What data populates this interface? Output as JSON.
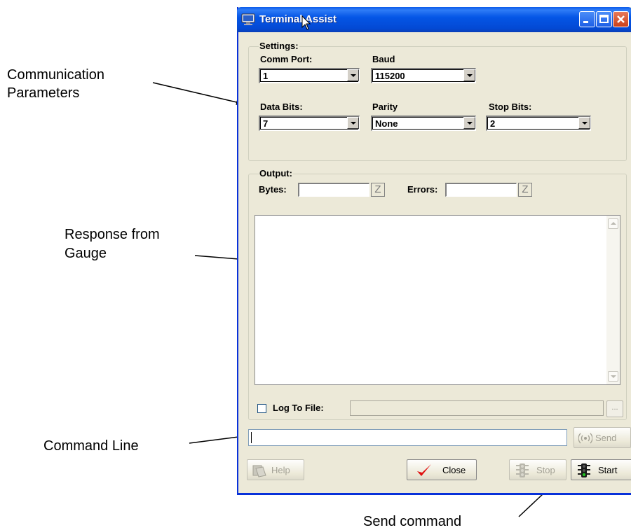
{
  "annotations": {
    "comm_params_line1": "Communication",
    "comm_params_line2": "Parameters",
    "response_line1": "Response from",
    "response_line2": "Gauge",
    "command_line": "Command Line",
    "send_command": "Send command"
  },
  "window": {
    "title": "Terminal Assist"
  },
  "settings": {
    "legend": "Settings:",
    "comm_port_label": "Comm Port:",
    "comm_port_value": "1",
    "baud_label": "Baud",
    "baud_value": "115200",
    "data_bits_label": "Data Bits:",
    "data_bits_value": "7",
    "parity_label": "Parity",
    "parity_value": "None",
    "stop_bits_label": "Stop Bits:",
    "stop_bits_value": "2"
  },
  "output": {
    "legend": "Output:",
    "bytes_label": "Bytes:",
    "bytes_value": "",
    "zero_label": "Z",
    "errors_label": "Errors:",
    "errors_value": "",
    "log_to_file_label": "Log To File:",
    "log_to_file_value": "",
    "log_to_file_checked": false,
    "browse_label": "..."
  },
  "command": {
    "value": "",
    "send_label": "Send"
  },
  "buttons": {
    "help": "Help",
    "close": "Close",
    "stop": "Stop",
    "start": "Start"
  },
  "colors": {
    "window_bg": "#ece9d8",
    "titlebar_blue": "#0556e6",
    "close_red": "#d9482a",
    "check_red": "#e01010",
    "traffic_green": "#20a020"
  }
}
